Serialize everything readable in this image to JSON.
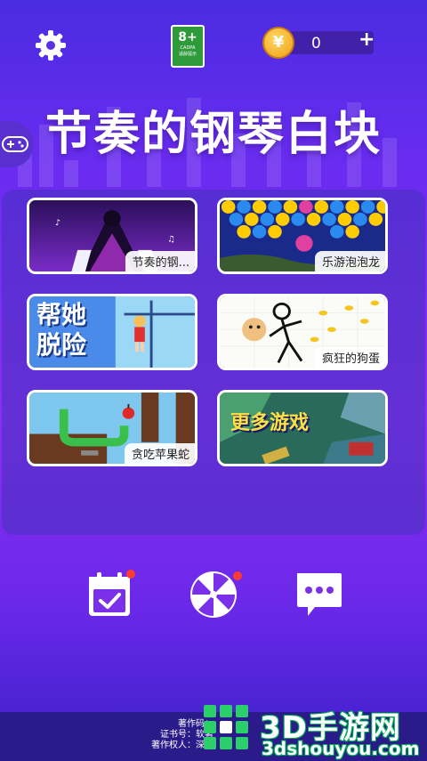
{
  "header": {
    "age_rating": {
      "value": "8+",
      "org": "CADPA",
      "caption": "适龄提示"
    },
    "coins": {
      "count": "0",
      "currency_symbol": "¥",
      "add_label": "+"
    }
  },
  "title": "节奏的钢琴白块",
  "games": [
    {
      "label": "节奏的钢...",
      "art": "piano-dancer",
      "art_title": ""
    },
    {
      "label": "乐游泡泡龙",
      "art": "bubble-shooter",
      "art_title": ""
    },
    {
      "label": "",
      "art": "help-her-escape",
      "art_title": "帮她脱险"
    },
    {
      "label": "疯狂的狗蛋",
      "art": "crazy-doge",
      "art_title": ""
    },
    {
      "label": "贪吃苹果蛇",
      "art": "apple-snake",
      "art_title": ""
    },
    {
      "label": "",
      "art": "more-games",
      "art_title": "更多游戏"
    }
  ],
  "bottom_nav": [
    {
      "name": "calendar-checkin-icon",
      "has_badge": true
    },
    {
      "name": "lucky-wheel-icon",
      "has_badge": true
    },
    {
      "name": "chat-message-icon",
      "has_badge": false
    }
  ],
  "footer": {
    "lines": [
      "著作码：",
      "证书号：软著",
      "著作权人：深圳"
    ]
  },
  "watermark": {
    "title": "3D手游网",
    "url": "3dshouyou.com"
  },
  "colors": {
    "accent": "#8a2ef0",
    "badge": "#ff3b30",
    "coin": "#f0a01a"
  }
}
